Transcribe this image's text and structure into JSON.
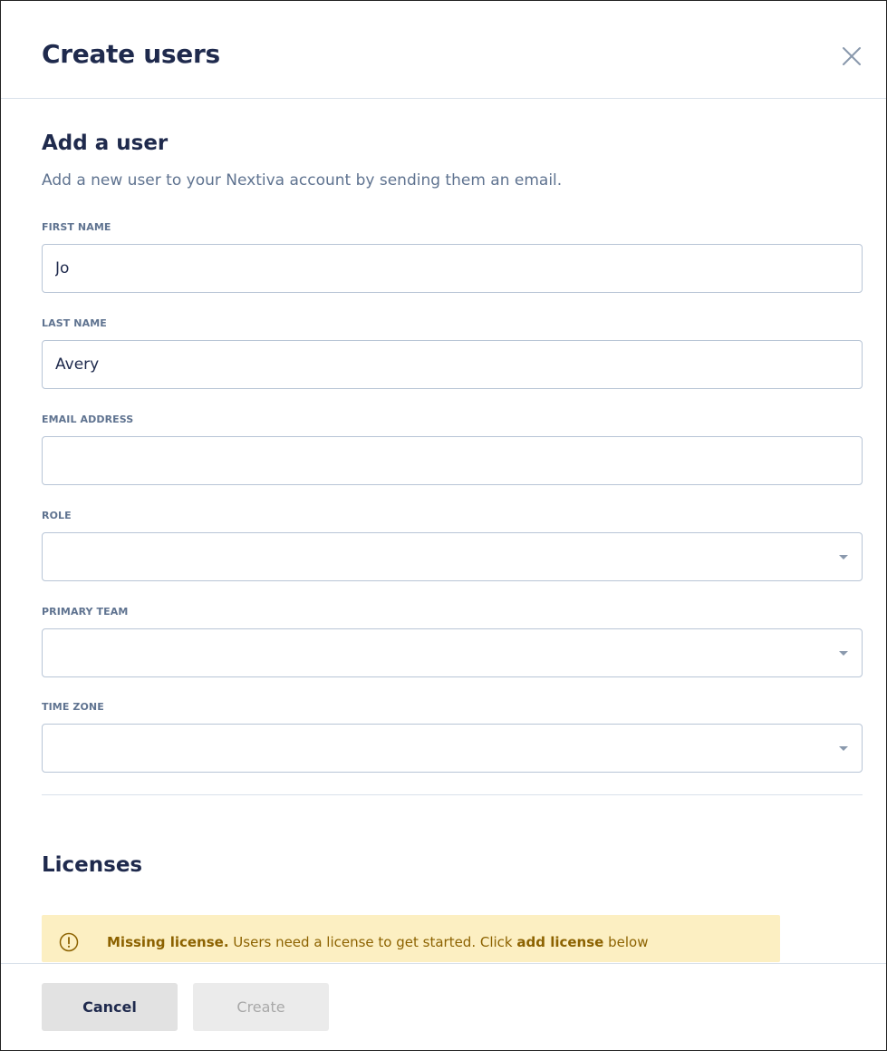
{
  "modal": {
    "title": "Create users",
    "close_icon": "close-icon"
  },
  "add_user": {
    "heading": "Add a user",
    "subtitle": "Add a new user to your Nextiva account by sending them an email."
  },
  "fields": {
    "first_name": {
      "label": "FIRST NAME",
      "value": "Jo"
    },
    "last_name": {
      "label": "LAST NAME",
      "value": "Avery"
    },
    "email": {
      "label": "EMAIL ADDRESS",
      "value": ""
    },
    "role": {
      "label": "ROLE",
      "value": ""
    },
    "primary_team": {
      "label": "PRIMARY TEAM",
      "value": ""
    },
    "time_zone": {
      "label": "TIME ZONE",
      "value": ""
    }
  },
  "licenses": {
    "heading": "Licenses",
    "alert": {
      "icon": "exclamation-circle-icon",
      "strong": "Missing license.",
      "text_before_link": " Users need a license to get started. Click ",
      "link": "add license",
      "text_after_link": " below"
    }
  },
  "footer": {
    "cancel_label": "Cancel",
    "create_label": "Create"
  },
  "colors": {
    "heading": "#1f2a4d",
    "muted": "#5f7390",
    "alert_bg": "#fcefc2",
    "alert_text": "#8c6200"
  }
}
